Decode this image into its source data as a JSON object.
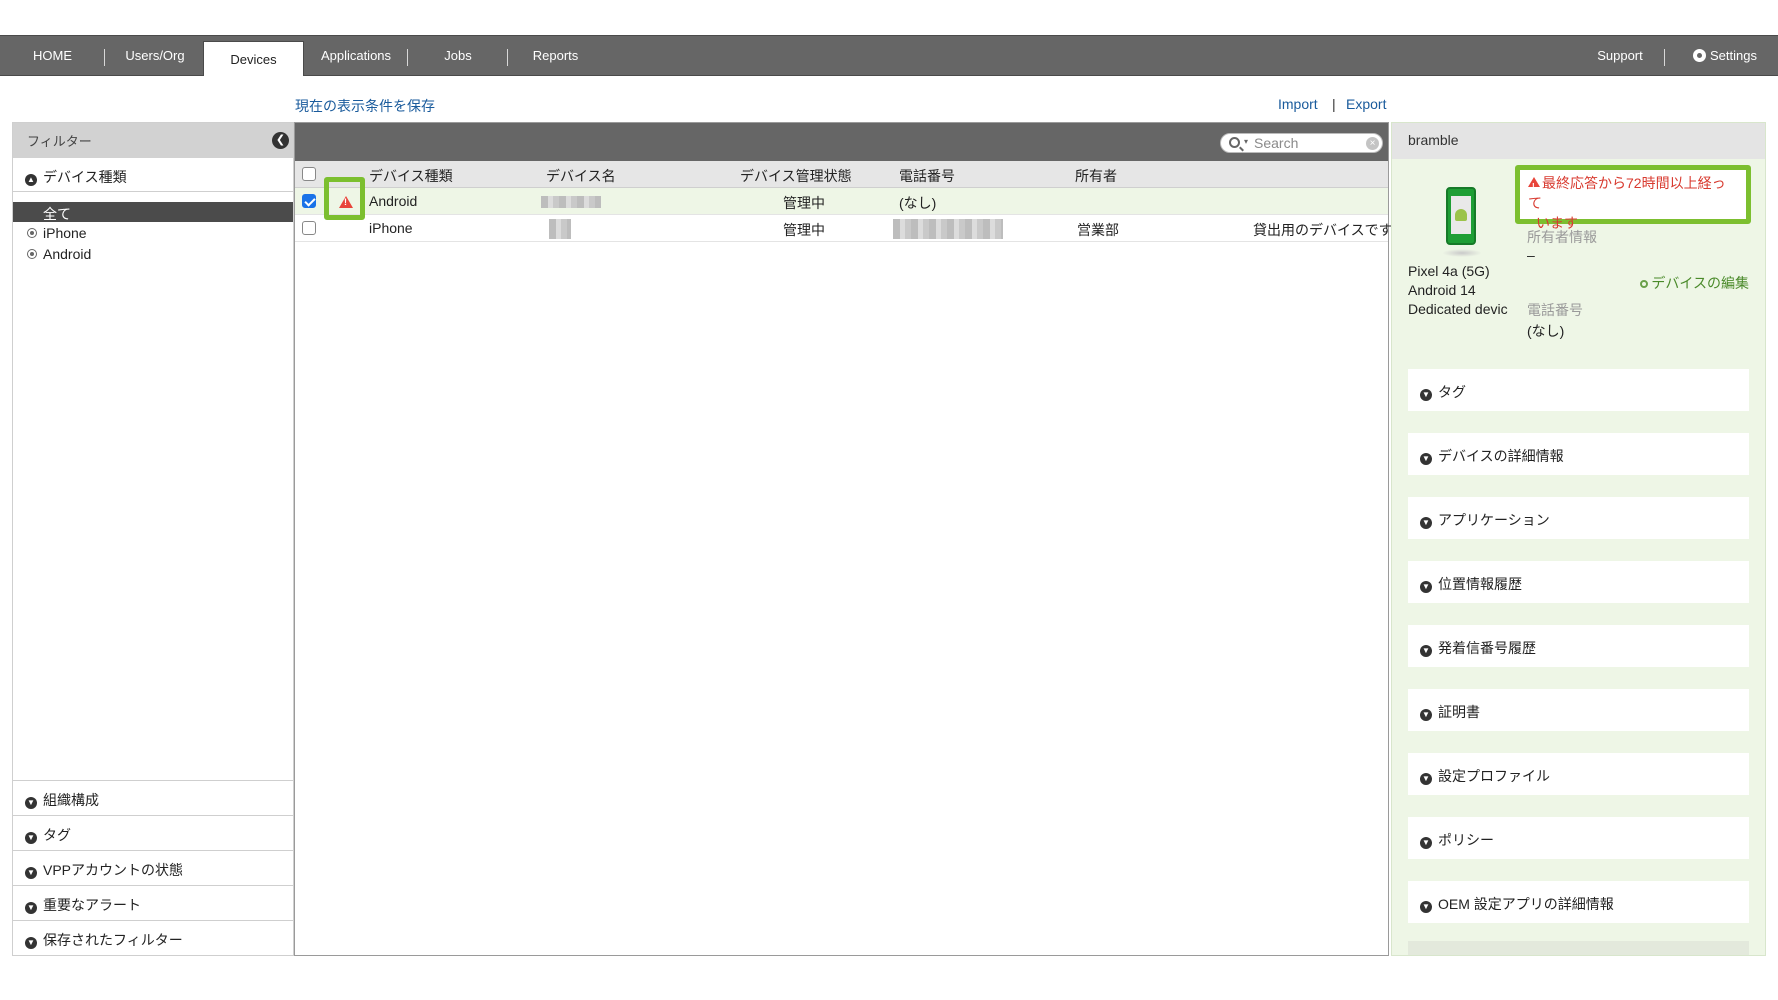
{
  "nav": {
    "tabs": [
      {
        "label": "HOME"
      },
      {
        "label": "Users/Org"
      },
      {
        "label": "Devices"
      },
      {
        "label": "Applications"
      },
      {
        "label": "Jobs"
      },
      {
        "label": "Reports"
      }
    ],
    "support": "Support",
    "settings": "Settings"
  },
  "actions": {
    "save_view": "現在の表示条件を保存",
    "import": "Import",
    "pipe": "|",
    "export": "Export"
  },
  "filter_panel": {
    "header": "フィルター",
    "collapse_glyph": "❮",
    "device_type_title": "デバイス種類",
    "options": {
      "all": "全て",
      "iphone": "iPhone",
      "android": "Android"
    },
    "sections": [
      "組織構成",
      "タグ",
      "VPPアカウントの状態",
      "重要なアラート",
      "保存されたフィルター"
    ]
  },
  "search": {
    "placeholder": "Search",
    "caret": "▾",
    "clear": "×"
  },
  "table": {
    "columns": [
      "デバイス種類",
      "デバイス名",
      "デバイス管理状態",
      "電話番号",
      "所有者"
    ],
    "rows": [
      {
        "type": "Android",
        "status": "管理中",
        "phone": "(なし)",
        "owner": "",
        "note": "",
        "checked": true,
        "alert": true
      },
      {
        "type": "iPhone",
        "status": "管理中",
        "phone": "",
        "owner": "営業部",
        "note": "貸出用のデバイスです",
        "checked": false,
        "alert": false
      }
    ]
  },
  "detail": {
    "device_name": "bramble",
    "model": "Pixel 4a (5G)",
    "os": "Android 14",
    "mode": "Dedicated devic",
    "alert_line1": "最終応答から72時間以上経って",
    "alert_line2": "います",
    "owner_info_label": "所有者情報",
    "owner_info_value": "–",
    "edit_link": "デバイスの編集",
    "phone_label": "電話番号",
    "phone_value": "(なし)",
    "accordions": [
      "タグ",
      "デバイスの詳細情報",
      "アプリケーション",
      "位置情報履歴",
      "発着信番号履歴",
      "証明書",
      "設定プロファイル",
      "ポリシー",
      "OEM 設定アプリの詳細情報"
    ]
  },
  "icons": {
    "warning": "warning-triangle-icon",
    "search": "search-icon",
    "gear": "gear-icon",
    "chevron": "chevron-down-icon"
  },
  "colors": {
    "nav_bg": "#666666",
    "link": "#1a5b9c",
    "highlight": "#7cbf2f",
    "alert_text": "#d83a2f",
    "selected_row": "#eef6e6",
    "detail_bg": "#eef6e6"
  }
}
